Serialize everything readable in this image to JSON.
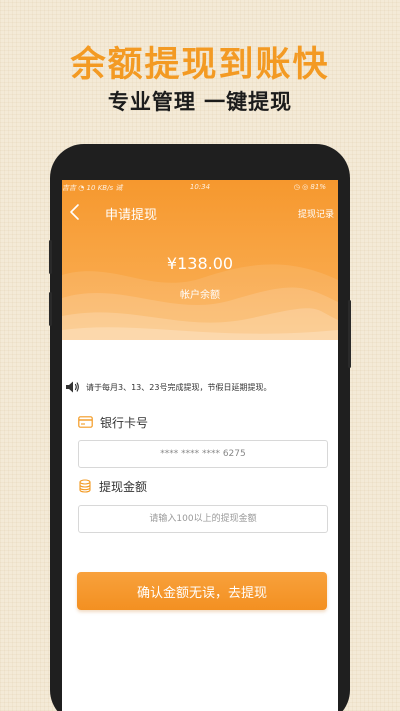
{
  "promo": {
    "title": "余额提现到账快",
    "subtitle": "专业管理 一键提现"
  },
  "status_bar": {
    "left": "吉吉 ◔ 10 KB/s 诫",
    "time": "10:34",
    "right": "◷ ◎ 81%"
  },
  "nav": {
    "back_icon": "chevron-left-icon",
    "title": "申请提现",
    "action": "提现记录"
  },
  "balance": {
    "amount": "¥138.00",
    "label": "帐户余额"
  },
  "notice": {
    "icon": "speaker-icon",
    "text": "请于每月3、13、23号完成提现，节假日延期提现。"
  },
  "bank_card": {
    "icon": "card-icon",
    "label": "银行卡号",
    "value": "**** **** **** 6275"
  },
  "amount": {
    "icon": "coins-icon",
    "label": "提现金额",
    "placeholder": "请输入100以上的提现金额"
  },
  "confirm_button": {
    "label": "确认金额无误，去提现"
  },
  "colors": {
    "brand_orange": "#f39a23",
    "header_gradient_top": "#f6982e",
    "button": "#f39021"
  }
}
